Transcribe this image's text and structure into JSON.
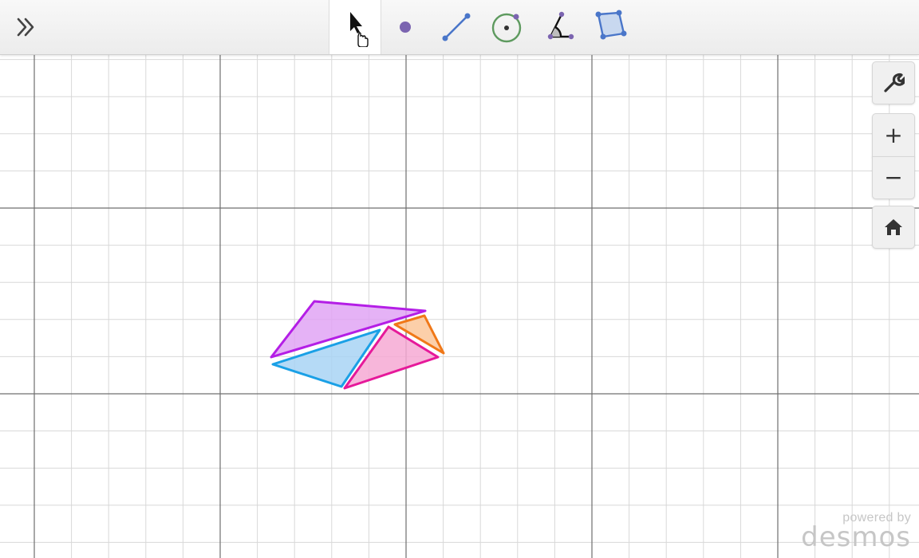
{
  "toolbar": {
    "expand_icon": "double-chevron-right-icon",
    "tools": [
      {
        "name": "select",
        "icon": "arrow-pointer-icon",
        "active": true
      },
      {
        "name": "point",
        "icon": "point-icon",
        "color": "#7b64b0"
      },
      {
        "name": "segment",
        "icon": "segment-icon",
        "color": "#4a76c9"
      },
      {
        "name": "circle",
        "icon": "circle-icon",
        "color": "#5e9a5f"
      },
      {
        "name": "angle",
        "icon": "angle-icon",
        "color": "#7b64b0"
      },
      {
        "name": "polygon",
        "icon": "polygon-icon",
        "color": "#4a76c9"
      }
    ]
  },
  "sidebar": {
    "settings_icon": "wrench-icon",
    "zoom_in_label": "+",
    "zoom_out_label": "−",
    "home_icon": "home-icon"
  },
  "shapes": [
    {
      "name": "purple-triangle",
      "stroke": "#b41ee6",
      "fill": "#e0a4f5"
    },
    {
      "name": "blue-triangle",
      "stroke": "#1aa0e6",
      "fill": "#a8d4f5"
    },
    {
      "name": "pink-triangle",
      "stroke": "#e6199a",
      "fill": "#f6a9d4"
    },
    {
      "name": "orange-triangle",
      "stroke": "#f07818",
      "fill": "#fbc79a"
    }
  ],
  "brand": {
    "powered_by": "powered by",
    "logo": "desmos"
  }
}
